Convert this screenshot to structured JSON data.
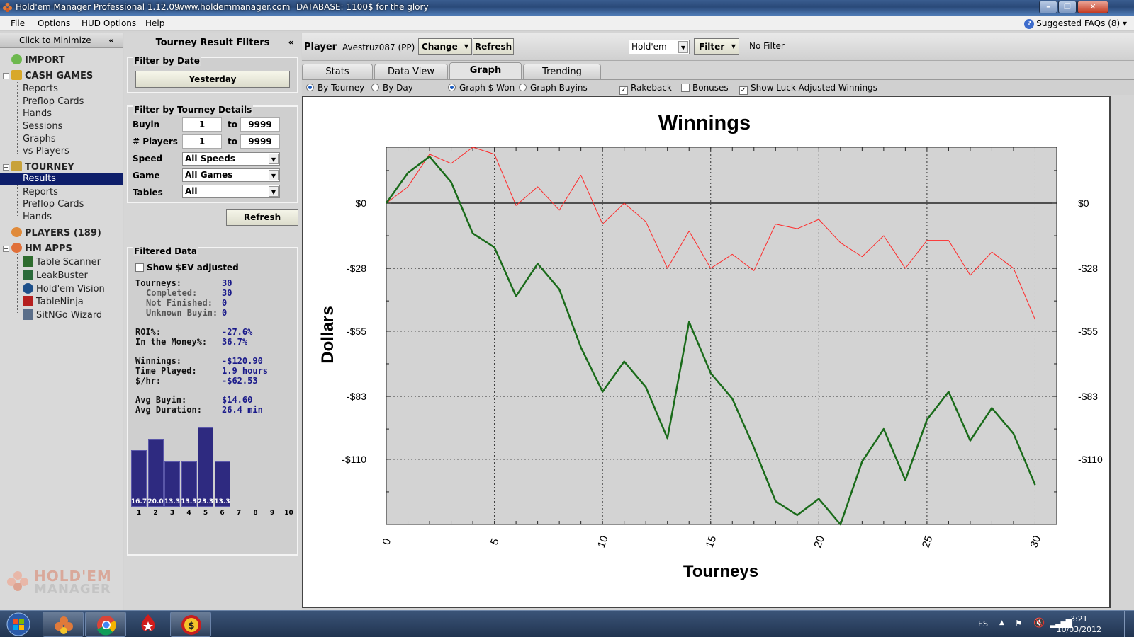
{
  "window": {
    "title": "Hold'em Manager Professional 1.12.09",
    "website": "www.holdemmanager.com",
    "database": "DATABASE: 1100$ for the glory"
  },
  "menu": {
    "items": [
      "File",
      "Options",
      "HUD Options",
      "Help"
    ],
    "faq": "Suggested FAQs (8)"
  },
  "sidebar": {
    "minimize_label": "Click to Minimize",
    "import": "IMPORT",
    "cash_games": {
      "label": "CASH GAMES",
      "items": [
        "Reports",
        "Preflop Cards",
        "Hands",
        "Sessions",
        "Graphs",
        "vs Players"
      ]
    },
    "tourney": {
      "label": "TOURNEY",
      "items": [
        "Results",
        "Reports",
        "Preflop Cards",
        "Hands"
      ],
      "selected": "Results"
    },
    "players": "PLAYERS (189)",
    "hm_apps": {
      "label": "HM APPS",
      "items": [
        "Table Scanner",
        "LeakBuster",
        "Hold'em Vision",
        "TableNinja",
        "SitNGo Wizard"
      ]
    },
    "logo_line1": "HOLD'EM",
    "logo_line2": "MANAGER"
  },
  "filters": {
    "title": "Tourney Result Filters",
    "by_date": {
      "title": "Filter by Date",
      "button": "Yesterday"
    },
    "by_details": {
      "title": "Filter by Tourney Details",
      "buyin": {
        "label": "Buyin",
        "from": "1",
        "to_label": "to",
        "to": "9999"
      },
      "players": {
        "label": "# Players",
        "from": "1",
        "to_label": "to",
        "to": "9999"
      },
      "speed": {
        "label": "Speed",
        "value": "All Speeds"
      },
      "game": {
        "label": "Game",
        "value": "All Games"
      },
      "tables": {
        "label": "Tables",
        "value": "All"
      }
    },
    "refresh": "Refresh",
    "filtered_data": {
      "title": "Filtered Data",
      "show_sev": "Show $EV adjusted",
      "tourneys_label": "Tourneys:",
      "tourneys": "30",
      "completed_label": "Completed:",
      "completed": "30",
      "not_finished_label": "Not Finished:",
      "not_finished": "0",
      "unknown_buyin_label": "Unknown Buyin:",
      "unknown_buyin": "0",
      "roi_label": "ROI%:",
      "roi": "-27.6%",
      "itm_label": "In the Money%:",
      "itm": "36.7%",
      "winnings_label": "Winnings:",
      "winnings": "-$120.90",
      "time_label": "Time Played:",
      "time": "1.9 hours",
      "rate_label": "$/hr:",
      "rate": "-$62.53",
      "avg_buyin_label": "Avg Buyin:",
      "avg_buyin": "$14.60",
      "avg_duration_label": "Avg Duration:",
      "avg_duration": "26.4 min"
    },
    "finish_chart": {
      "positions": [
        "1",
        "2",
        "3",
        "4",
        "5",
        "6",
        "7",
        "8",
        "9",
        "10"
      ],
      "values": [
        16.7,
        20.0,
        13.3,
        13.3,
        23.3,
        13.3,
        0,
        0,
        0,
        0
      ],
      "labels": [
        "16.7",
        "20.0",
        "13.3",
        "13.3",
        "23.3",
        "13.3",
        "",
        "",
        "",
        ""
      ]
    }
  },
  "playerbar": {
    "player_label": "Player",
    "player_name": "Avestruz087 (PP)",
    "change": "Change",
    "refresh": "Refresh",
    "game": "Hold'em",
    "filter": "Filter",
    "filter_status": "No Filter"
  },
  "tabs": [
    "Stats",
    "Data View",
    "Graph",
    "Trending"
  ],
  "active_tab": "Graph",
  "options": {
    "by_tourney": "By Tourney",
    "by_day": "By Day",
    "graph_won": "Graph $ Won",
    "graph_buyins": "Graph Buyins",
    "rakeback": "Rakeback",
    "bonuses": "Bonuses",
    "luck_adjusted": "Show Luck Adjusted Winnings"
  },
  "chart_data": {
    "type": "line",
    "title": "Winnings",
    "xlabel": "Tourneys",
    "ylabel": "Dollars",
    "xlim": [
      0,
      31
    ],
    "ylim": [
      -138,
      24
    ],
    "x_ticks": [
      0,
      5,
      10,
      15,
      20,
      25,
      30
    ],
    "y_ticks": [
      0,
      -28,
      -55,
      -83,
      -110
    ],
    "y_tick_labels": [
      "$0",
      "-$28",
      "-$55",
      "-$83",
      "-$110"
    ],
    "grid": true,
    "series": [
      {
        "color": "#1a6b1a",
        "values": [
          0,
          13,
          20,
          9,
          -13,
          -19,
          -40,
          -26,
          -37,
          -62,
          -81,
          -68,
          -79,
          -101,
          -51,
          -73,
          -84,
          -105,
          -128,
          -134,
          -127,
          -138,
          -111,
          -97,
          -119,
          -93,
          -81,
          -102,
          -88,
          -99,
          -121
        ]
      },
      {
        "color": "#ff2a2a",
        "values": [
          0,
          7,
          21,
          17,
          24,
          21,
          -1,
          7,
          -3,
          12,
          -9,
          0,
          -8,
          -28,
          -12,
          -28,
          -22,
          -29,
          -9,
          -11,
          -7,
          -17,
          -23,
          -14,
          -28,
          -16,
          -16,
          -31,
          -21,
          -28,
          -50
        ]
      }
    ]
  },
  "taskbar": {
    "lang": "ES",
    "time": "3:21",
    "date": "10/03/2012"
  },
  "colors": {
    "selection": "#0e1e6a",
    "bar": "#2e2a80",
    "stat_value": "#1a1a8a"
  }
}
